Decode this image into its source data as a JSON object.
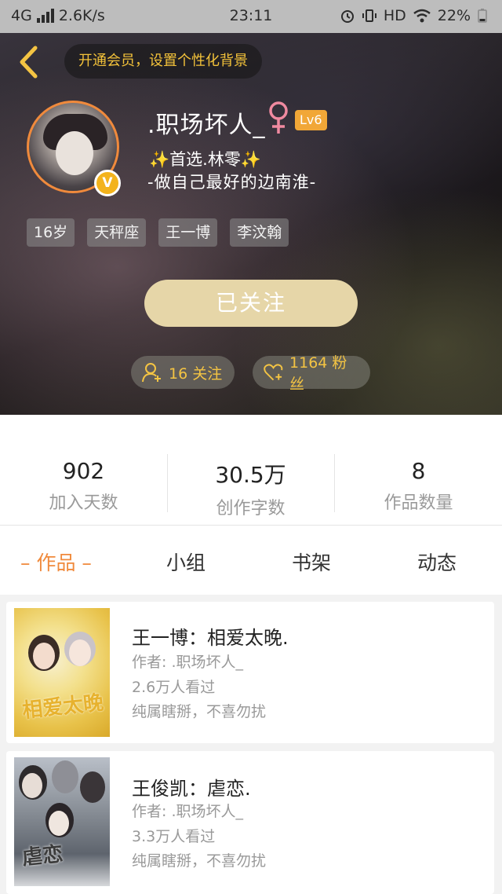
{
  "status_bar": {
    "network": "4G",
    "speed": "2.6K/s",
    "time": "23:11",
    "hd": "HD",
    "battery": "22%"
  },
  "header": {
    "vip_prompt": "开通会员，设置个性化背景",
    "username": ".职场坏人_",
    "level": "Lv6",
    "bio_line1": "✨首选.林零✨",
    "bio_line2": "-做自己最好的边南淮-",
    "tags": [
      "16岁",
      "天秤座",
      "王一博",
      "李汶翰"
    ],
    "follow_button": "已关注",
    "following": "16 关注",
    "followers": "1164 粉丝"
  },
  "stats": [
    {
      "value": "902",
      "label": "加入天数"
    },
    {
      "value": "30.5万",
      "label": "创作字数"
    },
    {
      "value": "8",
      "label": "作品数量"
    }
  ],
  "tabs": [
    "– 作品 –",
    "小组",
    "书架",
    "动态"
  ],
  "works": [
    {
      "title": "王一博：相爱太晚.",
      "author": "作者: .职场坏人_",
      "views": "2.6万人看过",
      "desc": "纯属瞎掰，不喜勿扰",
      "cover_text": "相爱太晚"
    },
    {
      "title": "王俊凯：虐恋.",
      "author": "作者: .职场坏人_",
      "views": "3.3万人看过",
      "desc": "纯属瞎掰，不喜勿扰",
      "cover_text": "虐恋"
    }
  ],
  "colors": {
    "accent": "#f08a3c",
    "gold": "#f4c443",
    "follow_button_bg": "#e6d6a8",
    "level_badge": "#f1a737"
  }
}
